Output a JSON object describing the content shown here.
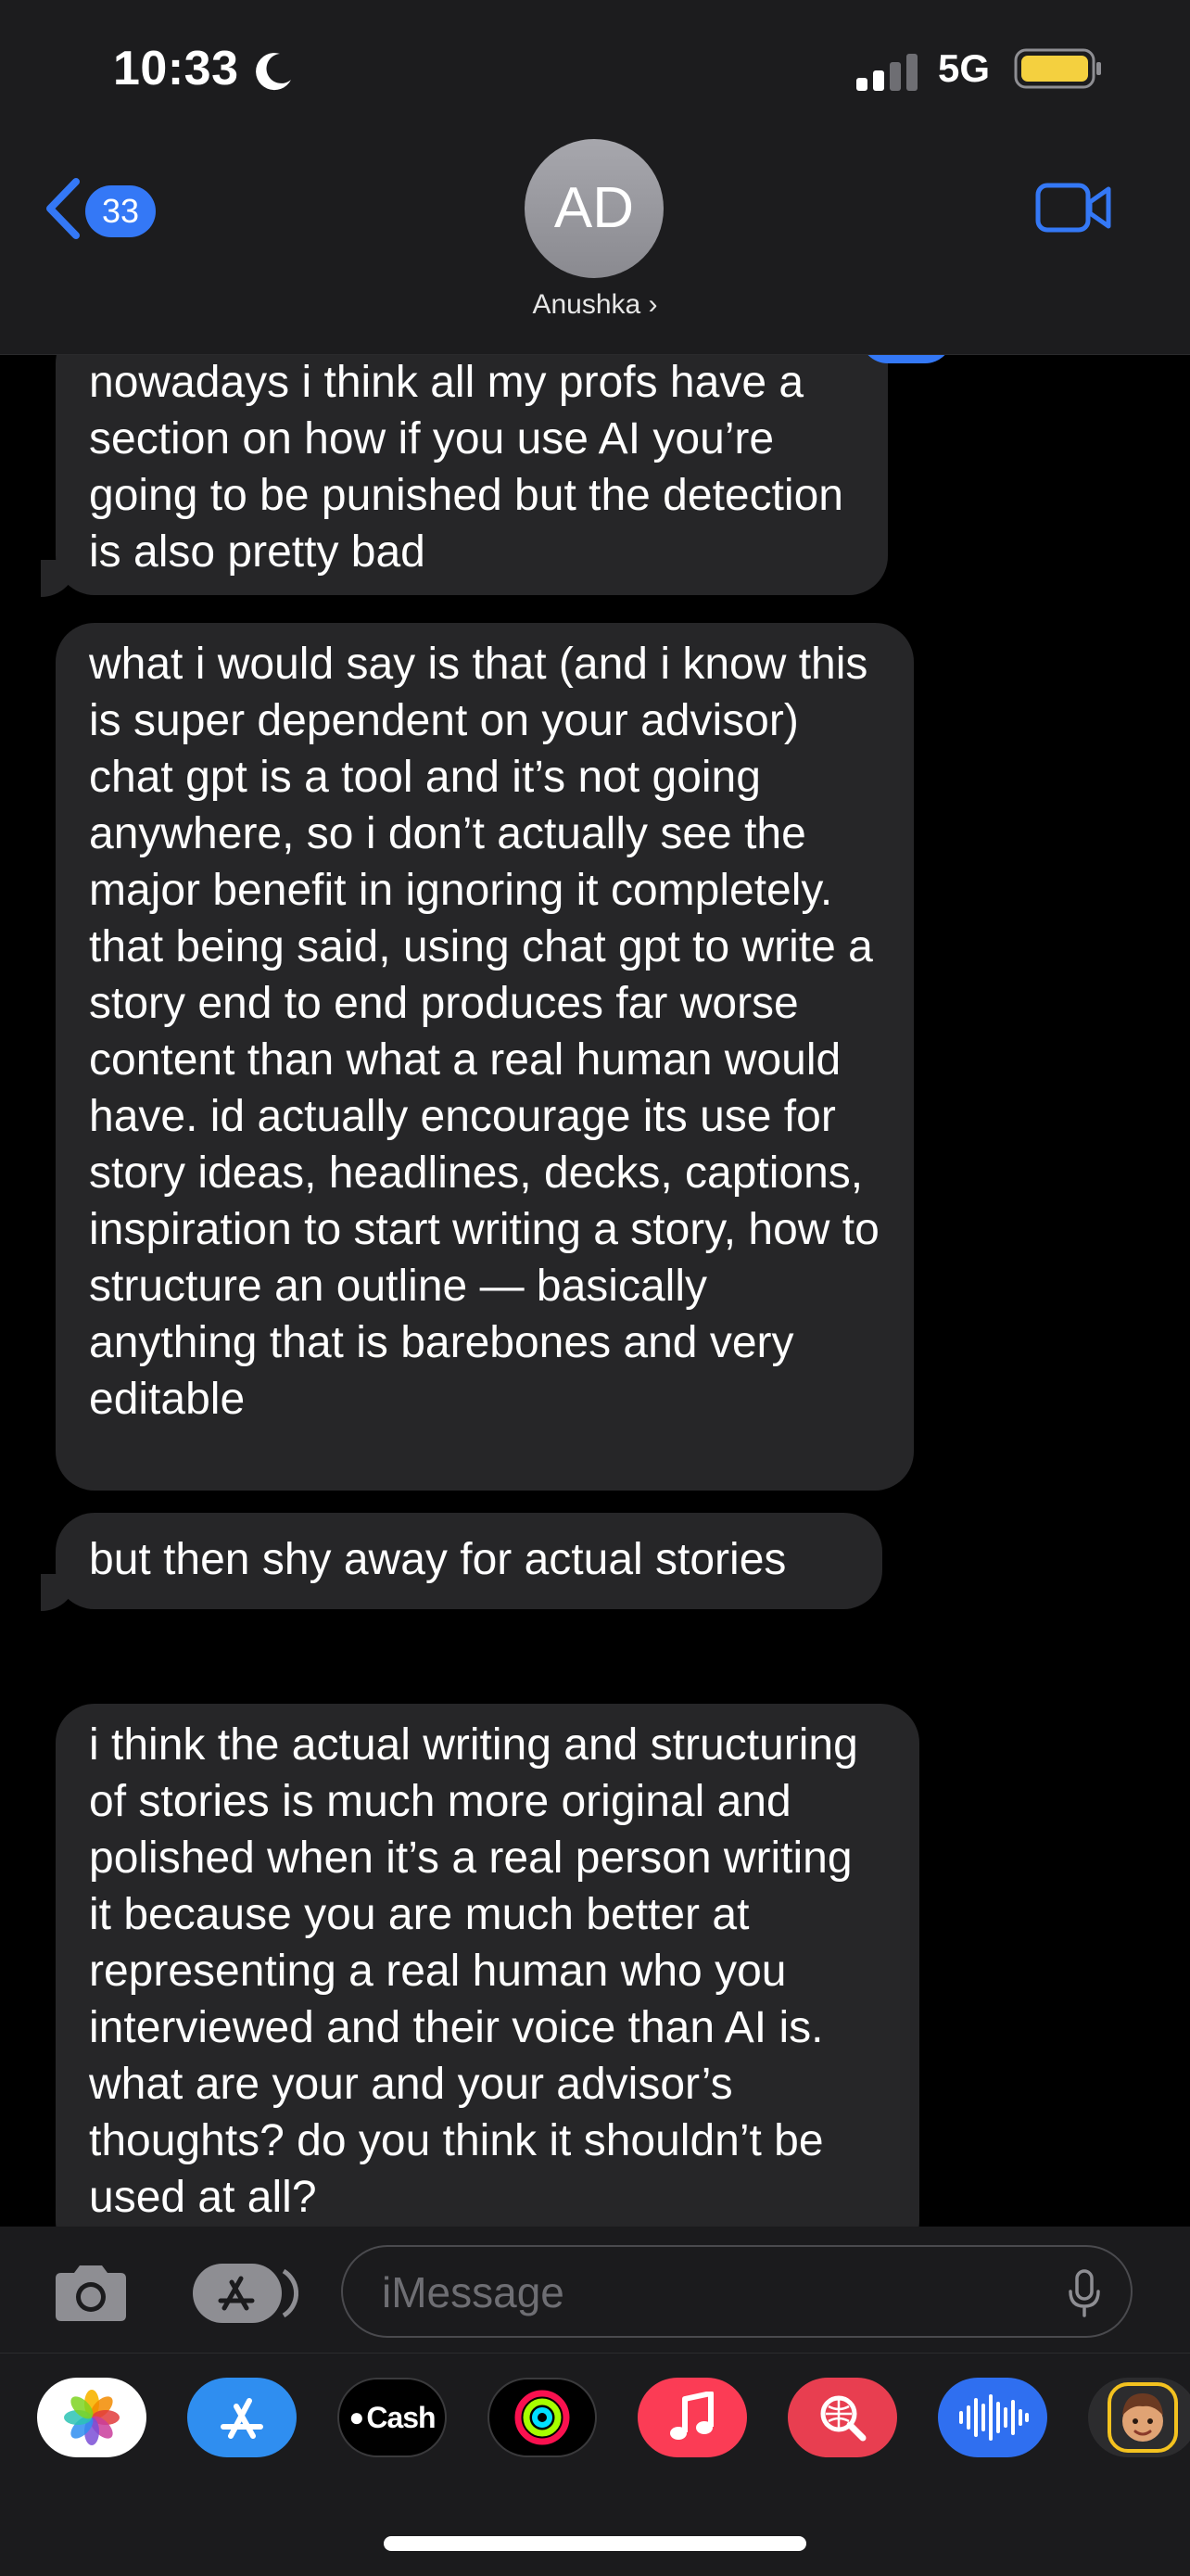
{
  "status_bar": {
    "time": "10:33",
    "network": "5G"
  },
  "header": {
    "back_count": "33",
    "avatar_initials": "AD",
    "contact_name": "Anushka ›"
  },
  "messages": [
    "nowadays i think all my profs have a section on how if you use AI you’re going to be punished but the detection is also pretty bad",
    "what i would say is that (and i know this is super dependent on your advisor) chat gpt is a tool and it’s not going anywhere, so i don’t actually see the major benefit in ignoring it completely. that being said, using chat gpt to write a story end to end produces far worse content than what a real human would have. id actually encourage its use for story ideas, headlines, decks, captions, inspiration to start writing a story, how to structure an outline — basically anything that is barebones and very editable",
    "but then shy away for actual stories",
    "i think the actual writing and structuring of stories is much more original and polished when it’s a real person writing it because you are much better at representing a real human who you interviewed and their voice than AI is. what are your and your advisor’s thoughts? do you think it shouldn’t be used at all?"
  ],
  "input": {
    "placeholder": "iMessage"
  },
  "app_drawer": {
    "apps": [
      "photos-icon",
      "app-store-icon",
      "apple-cash-icon",
      "activity-icon",
      "music-icon",
      "image-search-icon",
      "voice-memo-icon",
      "memoji-icon"
    ],
    "cash_label": "Cash"
  },
  "colors": {
    "accent": "#3478f6",
    "bubble": "#262628",
    "header": "#1c1c1e"
  }
}
